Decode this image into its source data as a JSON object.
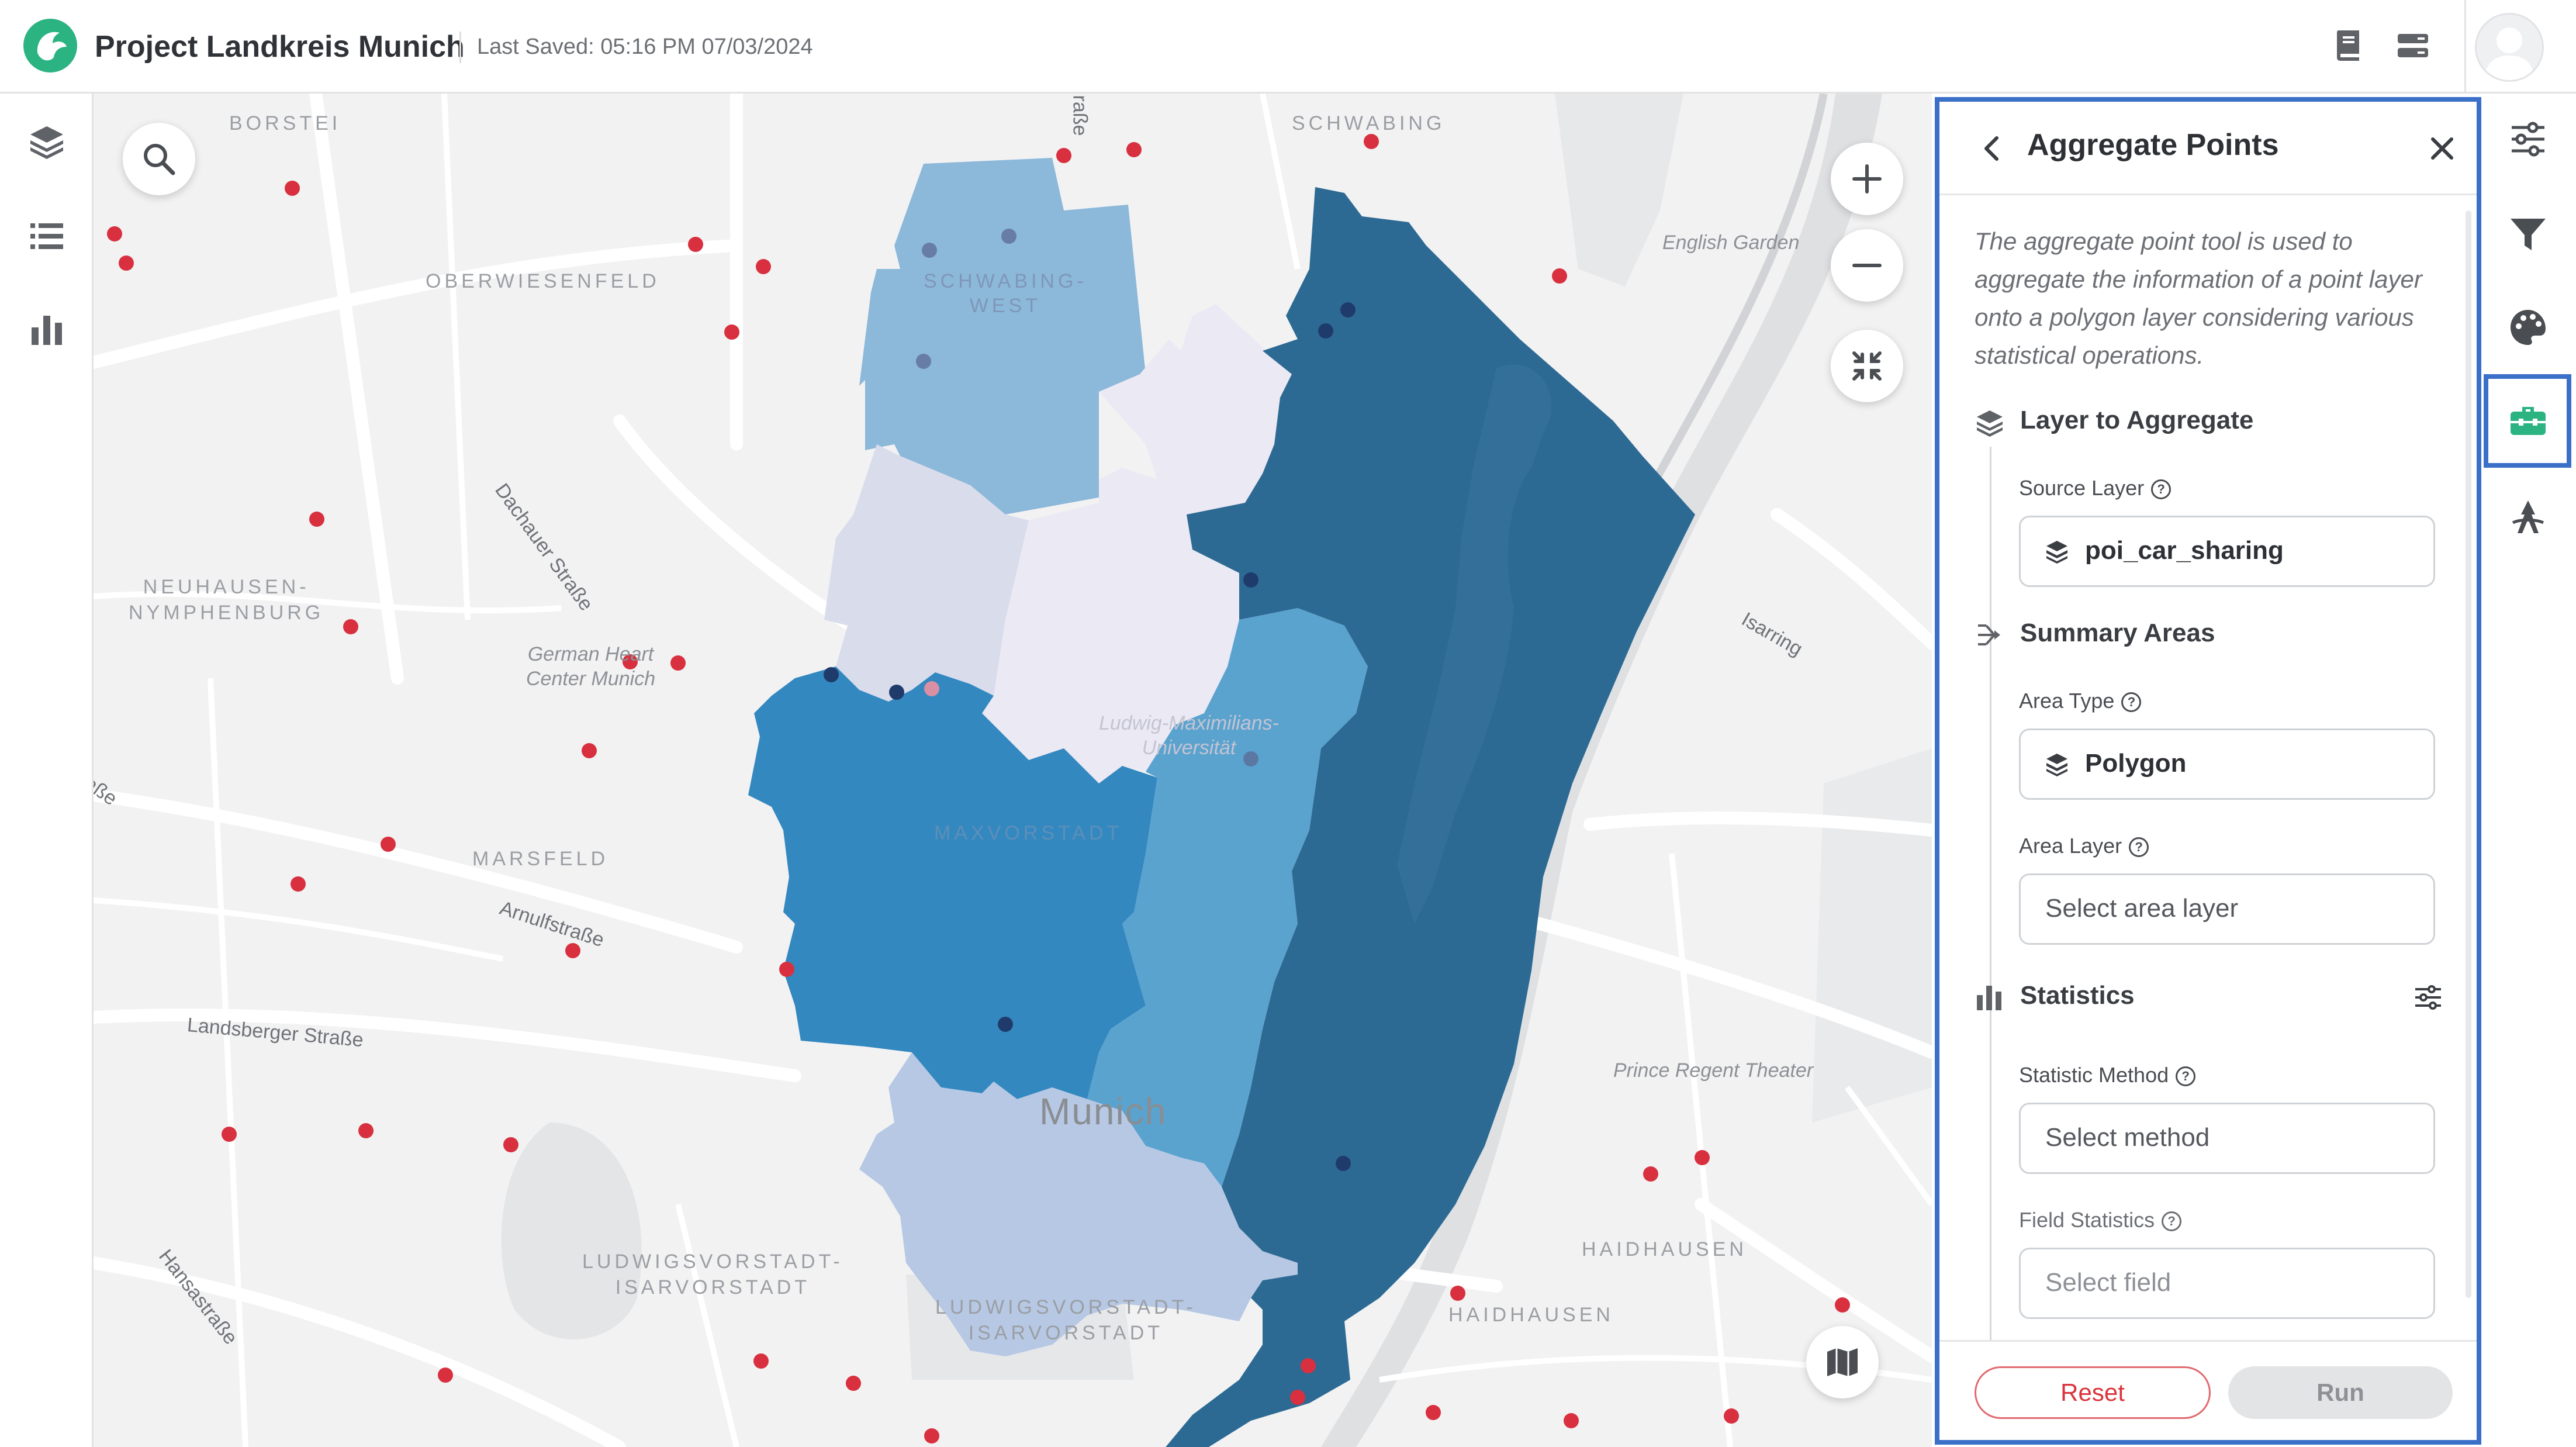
{
  "header": {
    "project_title": "Project Landkreis Munich",
    "last_saved": "Last Saved: 05:16 PM 07/03/2024",
    "icons": [
      "book-icon",
      "layers-toggle-icon",
      "user-avatar"
    ]
  },
  "left_rail": {
    "items": [
      "layers-icon",
      "legend-list-icon",
      "charts-icon"
    ]
  },
  "map": {
    "labels": {
      "borstei": "BORSTEI",
      "schwabing": "SCHWABING",
      "oberwiesenfeld": "OBERWIESENFELD",
      "schwabing_west": "SCHWABING-\nWEST",
      "english_garden": "English Garden",
      "dachauer": "Dachauer Straße",
      "neuhausen": "NEUHAUSEN-\nNYMPHENBURG",
      "german_heart": "German Heart\nCenter Munich",
      "isarring": "Isarring",
      "lmu": "Ludwig-Maximilians-\nUniversität",
      "marsfeld": "MARSFELD",
      "maxvorstadt": "MAXVORSTADT",
      "arnulf": "Arnulfstraße",
      "landsberger": "Landsberger Straße",
      "munich": "Munich",
      "prince_regent": "Prince Regent Theater",
      "hansastr": "Hansastraße",
      "ludwigsvorstadt_1": "LUDWIGSVORSTADT-\nISARVORSTADT",
      "ludwigsvorstadt_2": "LUDWIGSVORSTADT-\nISARVORSTADT",
      "haidhausen_1": "HAIDHAUSEN",
      "haidhausen_2": "HAIDHAUSEN",
      "strasse_top": "raße",
      "strasse_left": "raße"
    },
    "controls": [
      "search-icon",
      "zoom-in-icon",
      "zoom-out-icon",
      "fit-extent-icon",
      "basemap-icon"
    ],
    "colors": {
      "darkest": "#2d6a93",
      "dark": "#3388c0",
      "medium": "#5aa3cf",
      "light": "#8cb8da",
      "pale": "#b6c8e3",
      "lavender": "#d9dceb",
      "palest": "#ebe9f4",
      "points": "#d8303f"
    }
  },
  "panel": {
    "title": "Aggregate Points",
    "description": "The aggregate point tool is used to aggregate the information of a point layer onto a polygon layer considering various statistical operations.",
    "sections": {
      "layer": {
        "title": "Layer to Aggregate",
        "source_label": "Source Layer",
        "source_value": "poi_car_sharing"
      },
      "summary": {
        "title": "Summary Areas",
        "area_type_label": "Area Type",
        "area_type_value": "Polygon",
        "area_layer_label": "Area Layer",
        "area_layer_placeholder": "Select area layer"
      },
      "statistics": {
        "title": "Statistics",
        "method_label": "Statistic Method",
        "method_placeholder": "Select method",
        "field_label": "Field Statistics",
        "field_placeholder": "Select field"
      }
    },
    "reset_label": "Reset",
    "run_label": "Run"
  },
  "right_rail": {
    "items": [
      "layer-settings-icon",
      "filter-icon",
      "style-palette-icon",
      "toolbox-icon",
      "scenario-tools-icon"
    ],
    "active": "toolbox-icon",
    "accent": "#3b70c9"
  }
}
